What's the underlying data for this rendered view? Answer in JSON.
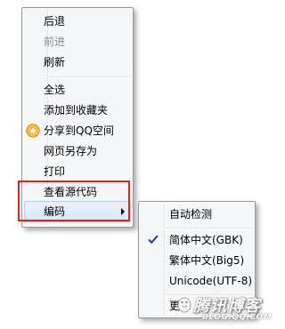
{
  "main_menu": {
    "items": [
      {
        "label": "后退",
        "enabled": true
      },
      {
        "label": "前进",
        "enabled": false
      },
      {
        "label": "刷新",
        "enabled": true
      },
      {
        "label": "全选",
        "enabled": true
      },
      {
        "label": "添加到收藏夹",
        "enabled": true
      },
      {
        "label": "分享到QQ空间",
        "enabled": true,
        "icon": "qzone-star-icon"
      },
      {
        "label": "网页另存为",
        "enabled": true
      },
      {
        "label": "打印",
        "enabled": true
      },
      {
        "label": "查看源代码",
        "enabled": true
      },
      {
        "label": "编码",
        "enabled": true,
        "submenu": true,
        "highlighted": true
      }
    ]
  },
  "encoding_submenu": {
    "items": [
      {
        "label": "自动检测"
      },
      {
        "label": "简体中文(GBK)",
        "checked": true
      },
      {
        "label": "繁体中文(Big5)"
      },
      {
        "label": "Unicode(UTF-8)"
      },
      {
        "label": "更多"
      }
    ]
  },
  "watermark": {
    "title": "腾讯博客",
    "subtitle": "BLOG.QQ.COM"
  },
  "colors": {
    "highlight_frame": "#e8201a",
    "menu_background": "#f5f6f8",
    "selection_border": "#aecff7"
  }
}
